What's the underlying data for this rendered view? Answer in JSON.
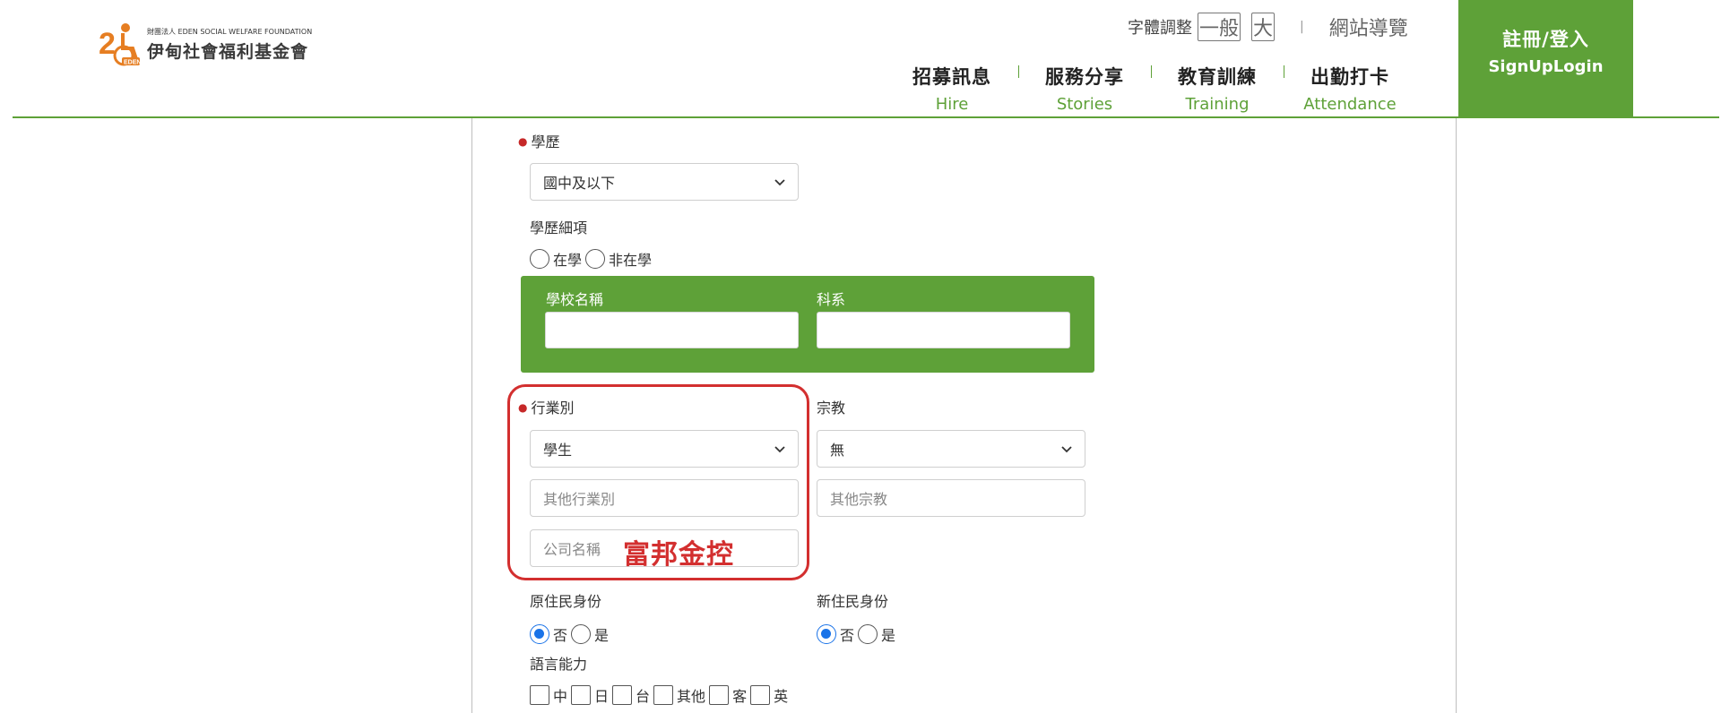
{
  "header": {
    "logo_small": "財團法人 EDEN SOCIAL WELFARE FOUNDATION",
    "logo_main": "伊甸社會福利基金會",
    "font_adjust_label": "字體調整",
    "font_normal": "一般",
    "font_large": "大",
    "separator": "|",
    "sitemap": "網站導覽",
    "nav": [
      {
        "zh": "招募訊息",
        "en": "Hire"
      },
      {
        "zh": "服務分享",
        "en": "Stories"
      },
      {
        "zh": "教育訓練",
        "en": "Training"
      },
      {
        "zh": "出勤打卡",
        "en": "Attendance"
      }
    ],
    "signup_zh": "註冊/登入",
    "signup_en": "SignUpLogin",
    "brand_color": "#5ea138"
  },
  "form": {
    "education_label": "學歷",
    "education_value": "國中及以下",
    "education_detail_label": "學歷細項",
    "enrollment_options": [
      "在學",
      "非在學"
    ],
    "school_name_label": "學校名稱",
    "department_label": "科系",
    "industry_label": "行業別",
    "industry_value": "學生",
    "other_industry_placeholder": "其他行業別",
    "company_placeholder": "公司名稱",
    "religion_label": "宗教",
    "religion_value": "無",
    "other_religion_placeholder": "其他宗教",
    "indigenous_label": "原住民身份",
    "indigenous_options": [
      "否",
      "是"
    ],
    "indigenous_selected": "否",
    "new_resident_label": "新住民身份",
    "new_resident_options": [
      "否",
      "是"
    ],
    "new_resident_selected": "否",
    "language_label": "語言能力",
    "language_options": [
      "中",
      "日",
      "台",
      "其他",
      "客",
      "英"
    ]
  },
  "annotation": {
    "text": "富邦金控",
    "color": "#d32f2f"
  }
}
